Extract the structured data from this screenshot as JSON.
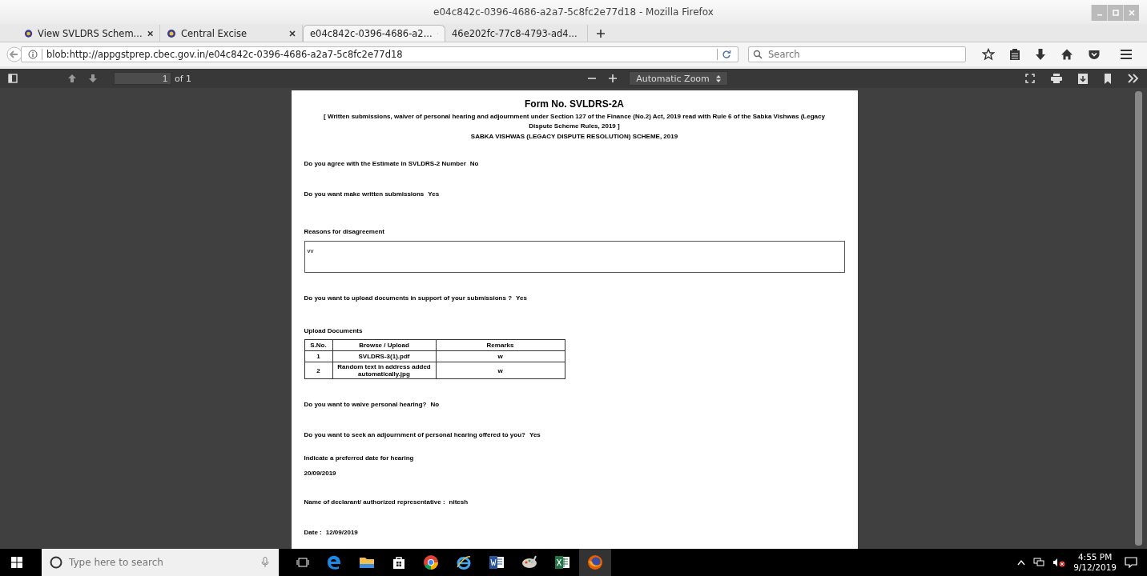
{
  "window": {
    "title": "e04c842c-0396-4686-a2a7-5c8fc2e77d18 - Mozilla Firefox"
  },
  "tabs": [
    {
      "label": "View SVLDRS Schem...",
      "selected": false,
      "favicon": true
    },
    {
      "label": "Central Excise",
      "selected": false,
      "favicon": true
    },
    {
      "label": "e04c842c-0396-4686-a2...",
      "selected": true,
      "favicon": false
    },
    {
      "label": "46e202fc-77c8-4793-ad4...",
      "selected": false,
      "favicon": false
    }
  ],
  "address_bar": {
    "url": "blob:http://appgstprep.cbec.gov.in/e04c842c-0396-4686-a2a7-5c8fc2e77d18"
  },
  "search": {
    "placeholder": "Search"
  },
  "pdf_toolbar": {
    "page_number": "1",
    "page_count": "of 1",
    "zoom": "Automatic Zoom"
  },
  "document": {
    "title": "Form No. SVLDRS-2A",
    "subtitle": "[ Written submissions, waiver of personal hearing and adjournment under Section 127 of the Finance (No.2) Act, 2019 read with Rule 6 of the Sabka Vishwas (Legacy Dispute Scheme Rules, 2019 ]",
    "scheme": "SABKA VISHWAS (LEGACY DISPUTE RESOLUTION) SCHEME, 2019",
    "sections": [
      {
        "kind": "qa",
        "label": "Do you agree with the Estimate in SVLDRS-2 Number",
        "answer": "No"
      },
      {
        "kind": "qa",
        "label": "Do you want make written submissions",
        "answer": "Yes"
      },
      {
        "kind": "textbox",
        "label": "Reasons for disagreement",
        "value": "vv"
      },
      {
        "kind": "qa",
        "label": "Do you want to upload documents in support of your submissions ?",
        "answer": "Yes"
      },
      {
        "kind": "table",
        "label": "Upload Documents",
        "columns": [
          "S.No.",
          "Browse / Upload",
          "Remarks"
        ],
        "rows": [
          [
            "1",
            "SVLDRS-3(1).pdf",
            "w"
          ],
          [
            "2",
            "Random text in address added automatically.jpg",
            "w"
          ]
        ]
      },
      {
        "kind": "qa",
        "label": "Do you want to waive personal hearing?",
        "answer": "No"
      },
      {
        "kind": "qa",
        "label": "Do you want to seek an adjournment of personal hearing offered to you?",
        "answer": "Yes"
      },
      {
        "kind": "stacked",
        "label": "Indicate a preferred date for hearing",
        "answer": "20/09/2019"
      },
      {
        "kind": "qa",
        "label": "Name of declarant/ authorized representative :",
        "answer": "nitesh"
      },
      {
        "kind": "qa",
        "label": "Date :",
        "answer": "12/09/2019"
      }
    ]
  },
  "taskbar": {
    "search_placeholder": "Type here to search",
    "time": "4:55 PM",
    "date": "9/12/2019"
  }
}
